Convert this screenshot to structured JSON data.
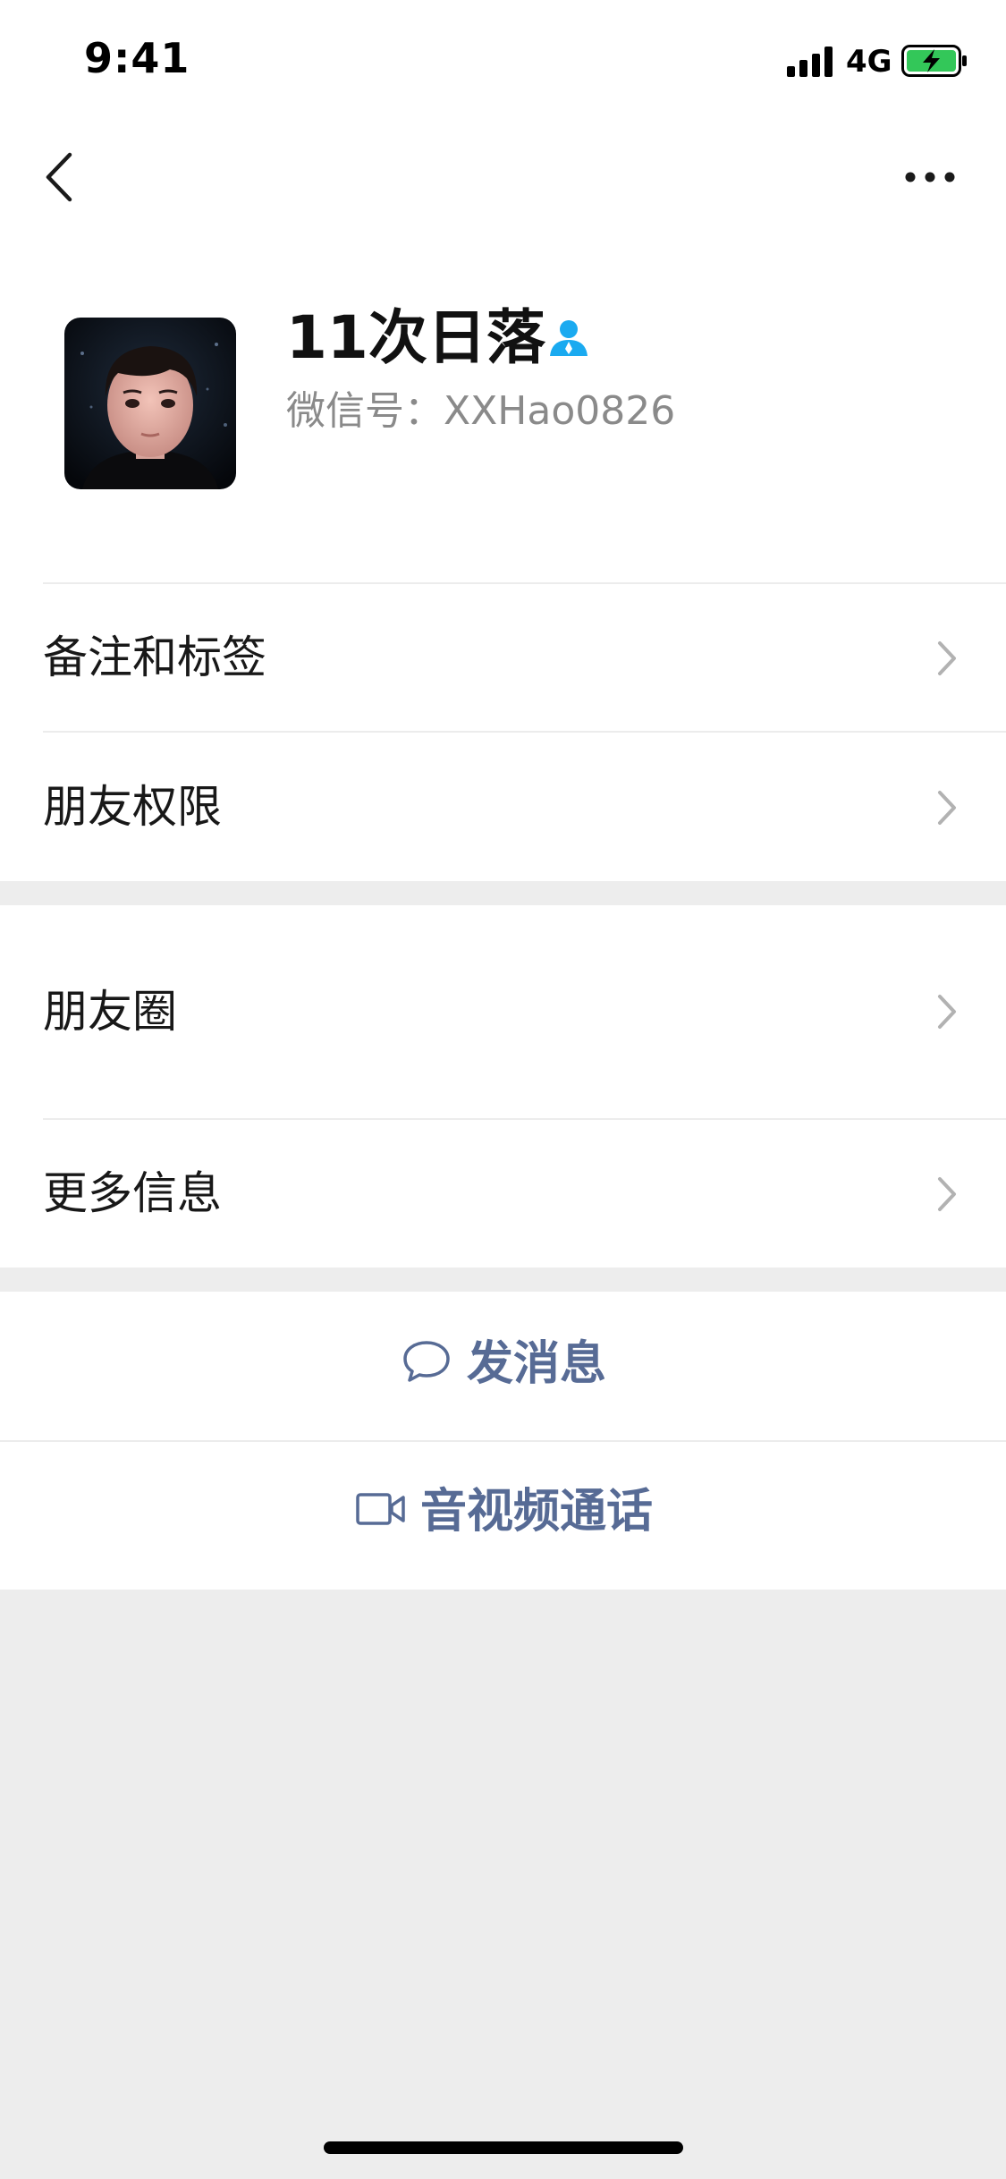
{
  "status_bar": {
    "time": "9:41",
    "network": "4G",
    "signal_icon": "signal-bars-icon",
    "battery_icon": "battery-charging-icon"
  },
  "nav": {
    "back_icon": "chevron-left-icon",
    "more_icon": "ellipsis-icon"
  },
  "profile": {
    "name": "11次日落",
    "wechat_id": "微信号：XXHao0826",
    "badge_icon": "contact-person-icon"
  },
  "sections": {
    "group1": [
      {
        "label": "备注和标签"
      },
      {
        "label": "朋友权限"
      }
    ],
    "group2": [
      {
        "label": "朋友圈"
      },
      {
        "label": "更多信息"
      }
    ]
  },
  "actions": {
    "send_message": "发消息",
    "video_call": "音视频通话"
  },
  "colors": {
    "background": "#ededed",
    "link": "#576b95",
    "badge_blue": "#1aaaf0",
    "battery_green": "#33c759"
  }
}
